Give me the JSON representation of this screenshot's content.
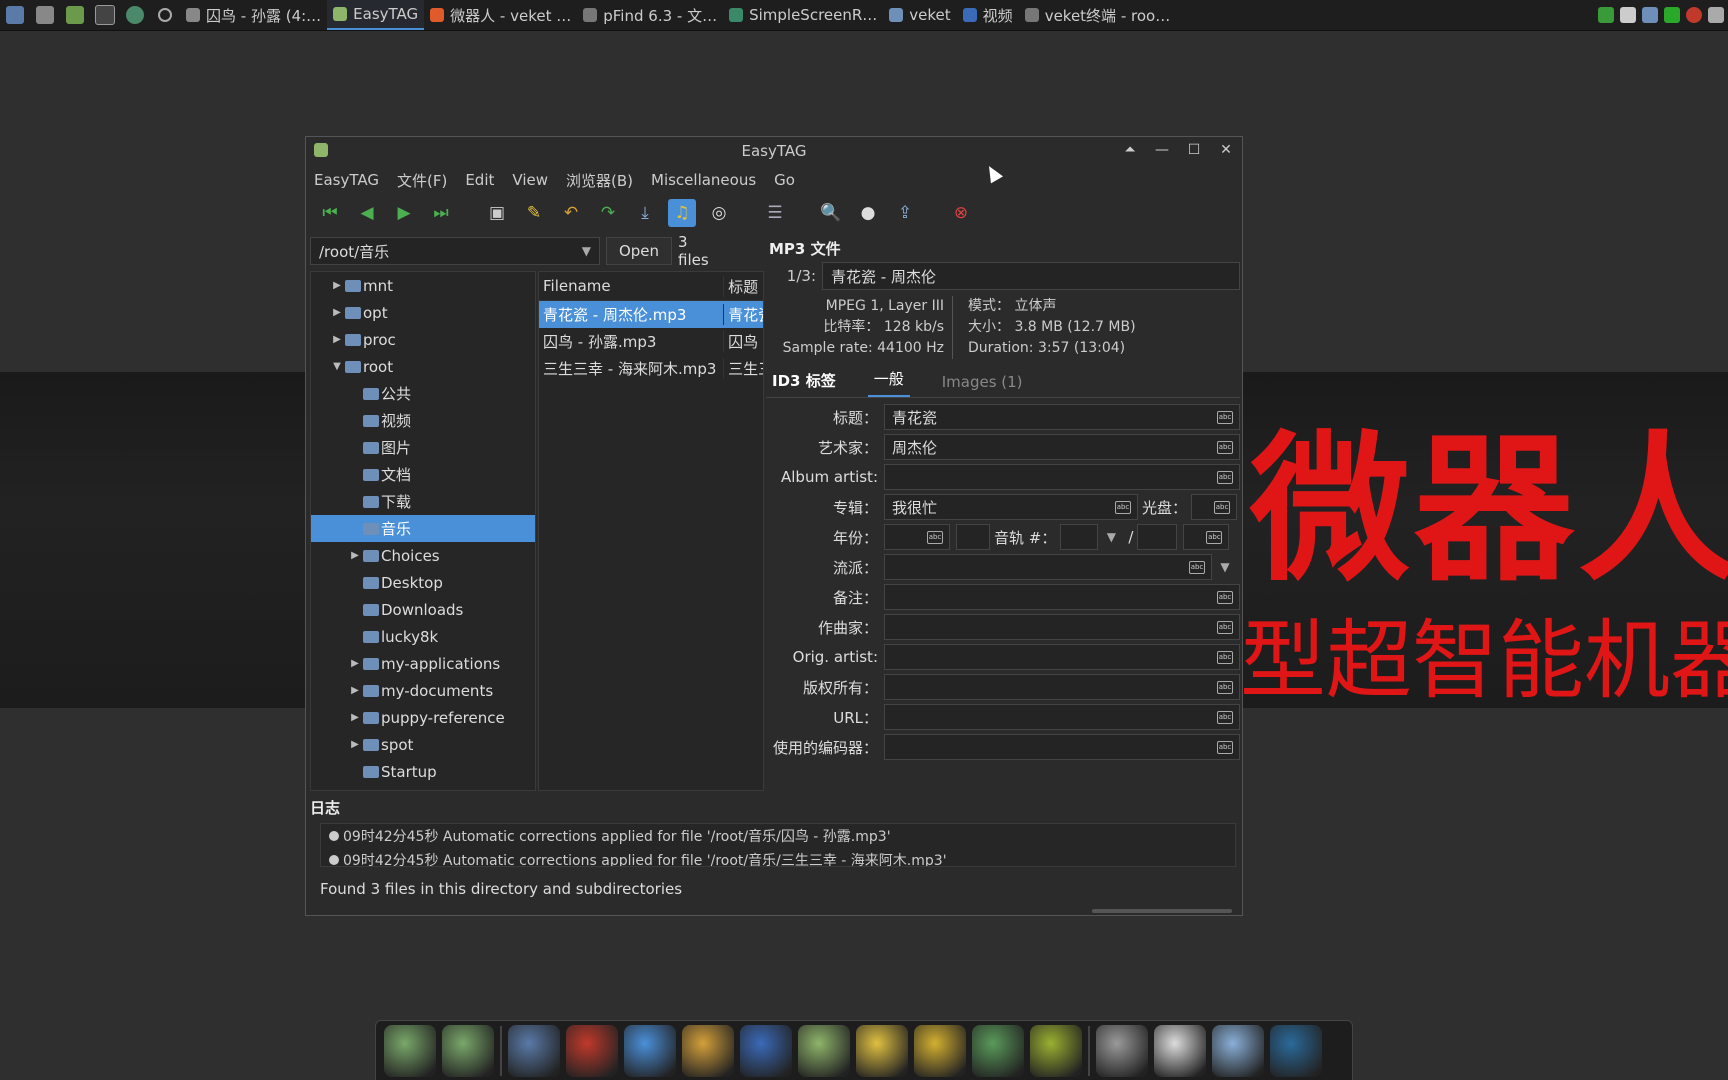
{
  "wallpaper": {
    "line1": "微器人",
    "line2": "型超智能机器"
  },
  "taskbar": {
    "tasks": [
      {
        "label": "囚鸟 - 孙露 (4:…",
        "color": "#888888",
        "active": false
      },
      {
        "label": "EasyTAG",
        "color": "#8fb56a",
        "active": true
      },
      {
        "label": "微器人 - veket …",
        "color": "#e05a2a",
        "active": false
      },
      {
        "label": "pFind 6.3 - 文…",
        "color": "#777777",
        "active": false
      },
      {
        "label": "SimpleScreenR…",
        "color": "#3a8a6a",
        "active": false
      },
      {
        "label": "veket",
        "color": "#6d8fb8",
        "active": false
      },
      {
        "label": "视频",
        "color": "#3a6ab8",
        "active": false
      },
      {
        "label": "veket终端 - roo…",
        "color": "#777777",
        "active": false
      }
    ]
  },
  "window": {
    "title": "EasyTAG",
    "menu": [
      "EasyTAG",
      "文件(F)",
      "Edit",
      "View",
      "浏览器(B)",
      "Miscellaneous",
      "Go"
    ]
  },
  "browser": {
    "path": "/root/音乐",
    "open_label": "Open",
    "file_count": "3 files",
    "tree": [
      {
        "label": "mnt",
        "indent": 1,
        "expander": "▶",
        "selected": false
      },
      {
        "label": "opt",
        "indent": 1,
        "expander": "▶",
        "selected": false
      },
      {
        "label": "proc",
        "indent": 1,
        "expander": "▶",
        "selected": false
      },
      {
        "label": "root",
        "indent": 1,
        "expander": "▼",
        "selected": false
      },
      {
        "label": "公共",
        "indent": 2,
        "expander": "",
        "selected": false
      },
      {
        "label": "视频",
        "indent": 2,
        "expander": "",
        "selected": false
      },
      {
        "label": "图片",
        "indent": 2,
        "expander": "",
        "selected": false
      },
      {
        "label": "文档",
        "indent": 2,
        "expander": "",
        "selected": false
      },
      {
        "label": "下载",
        "indent": 2,
        "expander": "",
        "selected": false
      },
      {
        "label": "音乐",
        "indent": 2,
        "expander": "",
        "selected": true
      },
      {
        "label": "Choices",
        "indent": 2,
        "expander": "▶",
        "selected": false
      },
      {
        "label": "Desktop",
        "indent": 2,
        "expander": "",
        "selected": false
      },
      {
        "label": "Downloads",
        "indent": 2,
        "expander": "",
        "selected": false
      },
      {
        "label": "lucky8k",
        "indent": 2,
        "expander": "",
        "selected": false
      },
      {
        "label": "my-applications",
        "indent": 2,
        "expander": "▶",
        "selected": false
      },
      {
        "label": "my-documents",
        "indent": 2,
        "expander": "▶",
        "selected": false
      },
      {
        "label": "puppy-reference",
        "indent": 2,
        "expander": "▶",
        "selected": false
      },
      {
        "label": "spot",
        "indent": 2,
        "expander": "▶",
        "selected": false
      },
      {
        "label": "Startup",
        "indent": 2,
        "expander": "",
        "selected": false
      }
    ],
    "columns": [
      "Filename",
      "标题"
    ],
    "files": [
      {
        "filename": "青花瓷 - 周杰伦.mp3",
        "title": "青花瓷",
        "selected": true
      },
      {
        "filename": "囚鸟 - 孙露.mp3",
        "title": "囚鸟",
        "selected": false
      },
      {
        "filename": "三生三幸 - 海来阿木.mp3",
        "title": "三生三幸",
        "selected": false
      }
    ]
  },
  "file_info": {
    "header": "MP3 文件",
    "index": "1/3:",
    "name": "青花瓷 - 周杰伦",
    "left": [
      {
        "label": "",
        "value": "MPEG 1, Layer III"
      },
      {
        "label": "比特率：",
        "value": "128 kb/s"
      },
      {
        "label": "Sample rate:",
        "value": "44100 Hz"
      }
    ],
    "right": [
      {
        "label": "模式：",
        "value": "立体声"
      },
      {
        "label": "大小：",
        "value": "3.8 MB (12.7 MB)"
      },
      {
        "label": "Duration:",
        "value": "3:57 (13:04)"
      }
    ]
  },
  "tag": {
    "section": "ID3 标签",
    "tabs": [
      "一般",
      "Images (1)"
    ],
    "fields": {
      "title": {
        "label": "标题：",
        "value": "青花瓷"
      },
      "artist": {
        "label": "艺术家：",
        "value": "周杰伦"
      },
      "album_artist": {
        "label": "Album artist:",
        "value": ""
      },
      "album": {
        "label": "专辑：",
        "value": "我很忙"
      },
      "disc": {
        "label": "光盘：",
        "value": ""
      },
      "year": {
        "label": "年份：",
        "value": ""
      },
      "track": {
        "label": "音轨 #：",
        "value": "",
        "sep": "/"
      },
      "genre": {
        "label": "流派：",
        "value": ""
      },
      "comment": {
        "label": "备注：",
        "value": ""
      },
      "composer": {
        "label": "作曲家：",
        "value": ""
      },
      "orig_artist": {
        "label": "Orig. artist:",
        "value": ""
      },
      "copyright": {
        "label": "版权所有：",
        "value": ""
      },
      "url": {
        "label": "URL：",
        "value": ""
      },
      "encoder": {
        "label": "使用的编码器：",
        "value": ""
      }
    }
  },
  "log": {
    "title": "日志",
    "lines": [
      "09时42分45秒 Automatic corrections applied for file '/root/音乐/囚鸟 - 孙露.mp3'",
      "09时42分45秒 Automatic corrections applied for file '/root/音乐/三生三幸 - 海来阿木.mp3'"
    ],
    "status": "Found 3 files in this directory and subdirectories"
  },
  "dock_colors": [
    "#7aa86a",
    "#7aa86a",
    "#5a7aa8",
    "#c0392b",
    "#4a90d9",
    "#d4a03a",
    "#3a6ab8",
    "#8fb56a",
    "#e0c040",
    "#d4b030",
    "#5a9a5a",
    "#9ab030",
    "#9a9a9a",
    "#dddddd",
    "#8ab0d8",
    "#2a6a9a"
  ]
}
